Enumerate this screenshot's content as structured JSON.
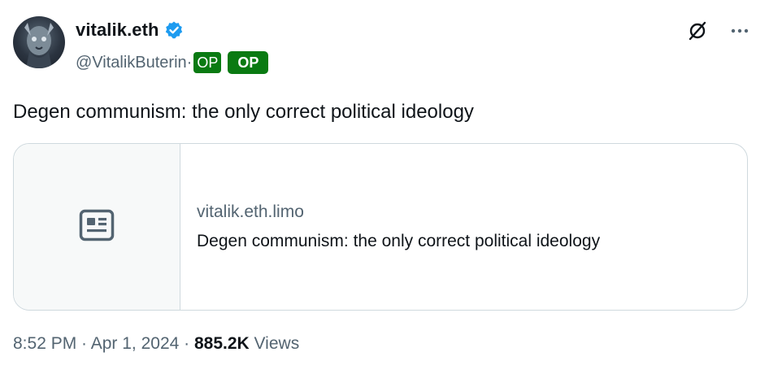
{
  "author": {
    "display_name": "vitalik.eth",
    "handle": "@VitalikButerin",
    "separator": "·",
    "op_badge_small": "OP",
    "op_badge_large": "OP",
    "verified_color": "#1d9bf0"
  },
  "actions": {
    "grok_icon": "grok-icon",
    "more_icon": "more-icon"
  },
  "tweet": {
    "text": "Degen communism: the only correct political ideology"
  },
  "link_card": {
    "thumbnail_icon": "article-icon",
    "domain": "vitalik.eth.limo",
    "title": "Degen communism: the only correct political ideology"
  },
  "meta": {
    "time": "8:52 PM",
    "dot1": " · ",
    "date": "Apr 1, 2024",
    "dot2": " · ",
    "views_count": "885.2K",
    "views_label": " Views"
  },
  "colors": {
    "op_green": "#0a7a12",
    "secondary_text": "#536471",
    "primary_text": "#0f1419",
    "card_border": "#cfd9de"
  }
}
